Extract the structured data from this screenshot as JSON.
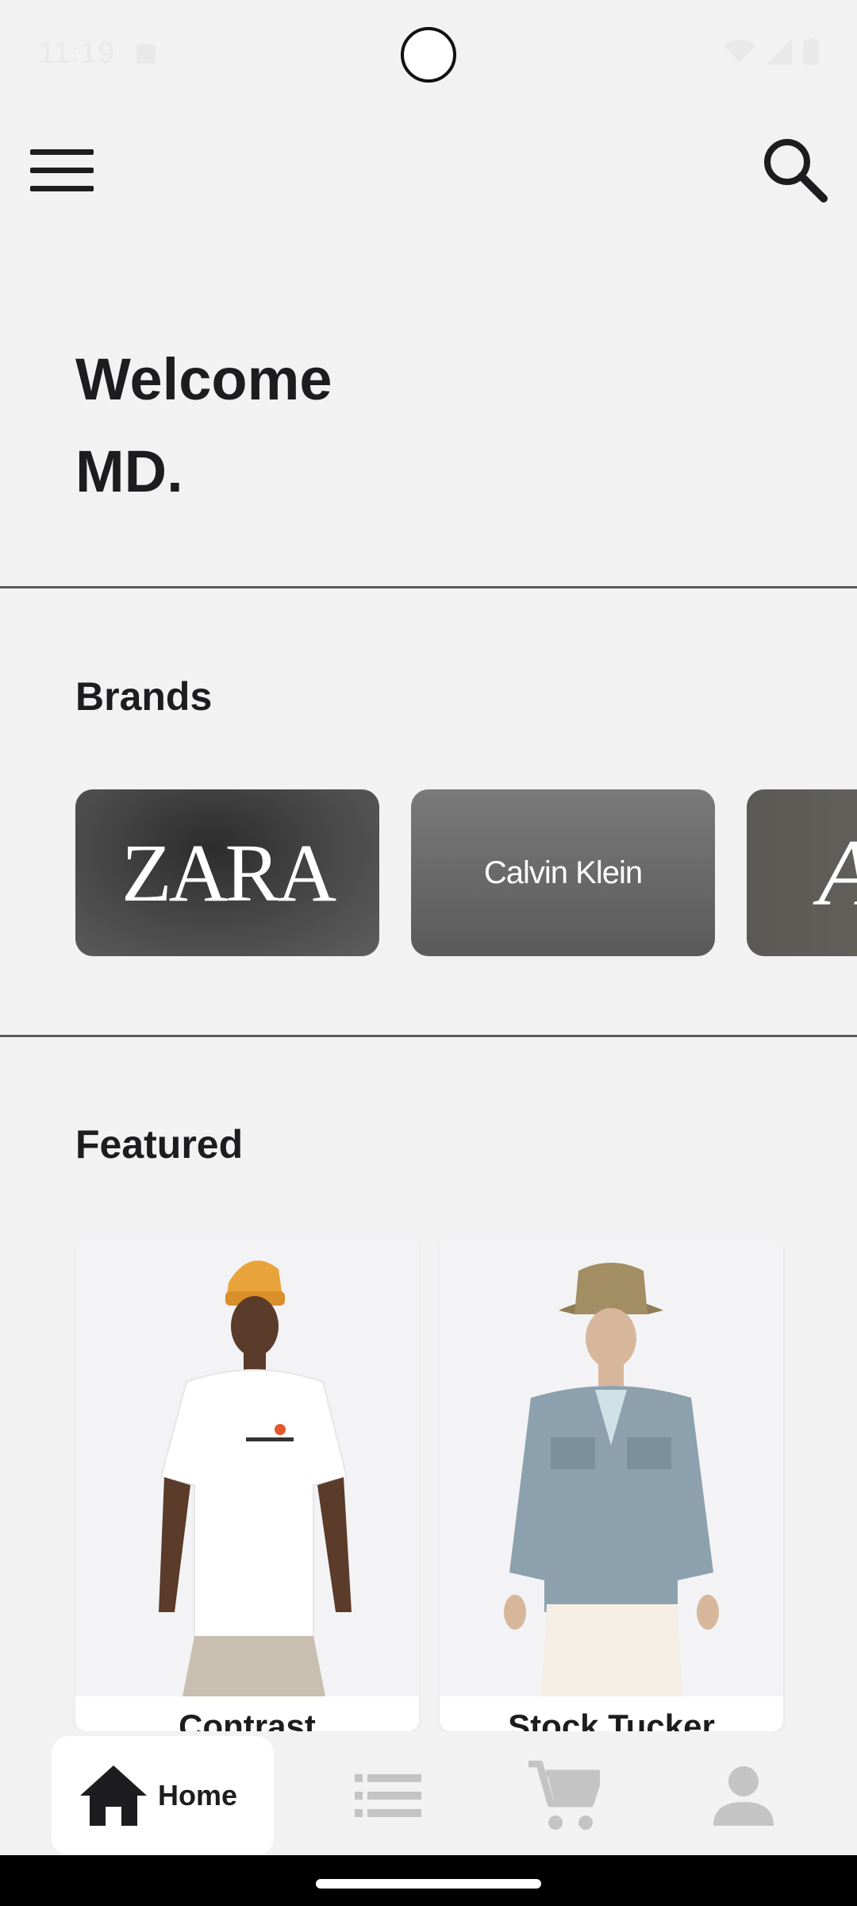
{
  "status_bar": {
    "time": "11:19"
  },
  "header": {
    "menu_icon": "menu-icon",
    "search_icon": "search-icon"
  },
  "welcome": {
    "line1": "Welcome",
    "line2": "MD."
  },
  "brands": {
    "title": "Brands",
    "items": [
      {
        "name": "ZARA"
      },
      {
        "name": "Calvin Klein"
      },
      {
        "name": "A"
      }
    ]
  },
  "featured": {
    "title": "Featured",
    "products": [
      {
        "name": "Contrast"
      },
      {
        "name": "Stock Tucker"
      }
    ]
  },
  "bottom_nav": {
    "home_label": "Home",
    "items": [
      "home-icon",
      "list-icon",
      "cart-icon",
      "profile-icon"
    ]
  },
  "colors": {
    "background": "#f2f2f2",
    "text": "#1d1d1f",
    "inactive_icon": "#c4c4c4"
  }
}
